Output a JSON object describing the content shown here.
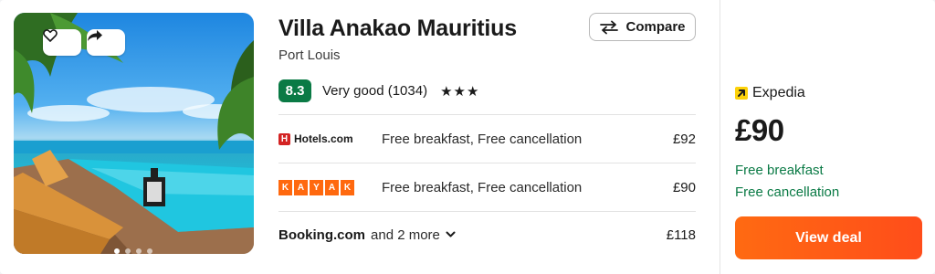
{
  "hotel": {
    "name": "Villa Anakao Mauritius",
    "location": "Port Louis",
    "score": "8.3",
    "rating_text": "Very good (1034)",
    "stars": "★★★"
  },
  "actions": {
    "compare_label": "Compare"
  },
  "image": {
    "slides_count": 4,
    "active_slide": 1
  },
  "offers": [
    {
      "provider": "Hotels.com",
      "description": "Free breakfast, Free cancellation",
      "price": "£92"
    },
    {
      "provider": "KAYAK",
      "description": "Free breakfast, Free cancellation",
      "price": "£90"
    }
  ],
  "more_offers": {
    "provider": "Booking.com",
    "more_text": "and 2 more",
    "price": "£118"
  },
  "featured": {
    "provider": "Expedia",
    "price": "£90",
    "perks": [
      "Free breakfast",
      "Free cancellation"
    ],
    "cta_label": "View deal"
  },
  "colors": {
    "score_bg": "#0a7a45",
    "cta": "#ff5a12",
    "perk_green": "#0a7a45"
  },
  "icons": [
    "heart-icon",
    "share-icon",
    "compare-arrows-icon",
    "chevron-down-icon",
    "expedia-logo-icon"
  ]
}
